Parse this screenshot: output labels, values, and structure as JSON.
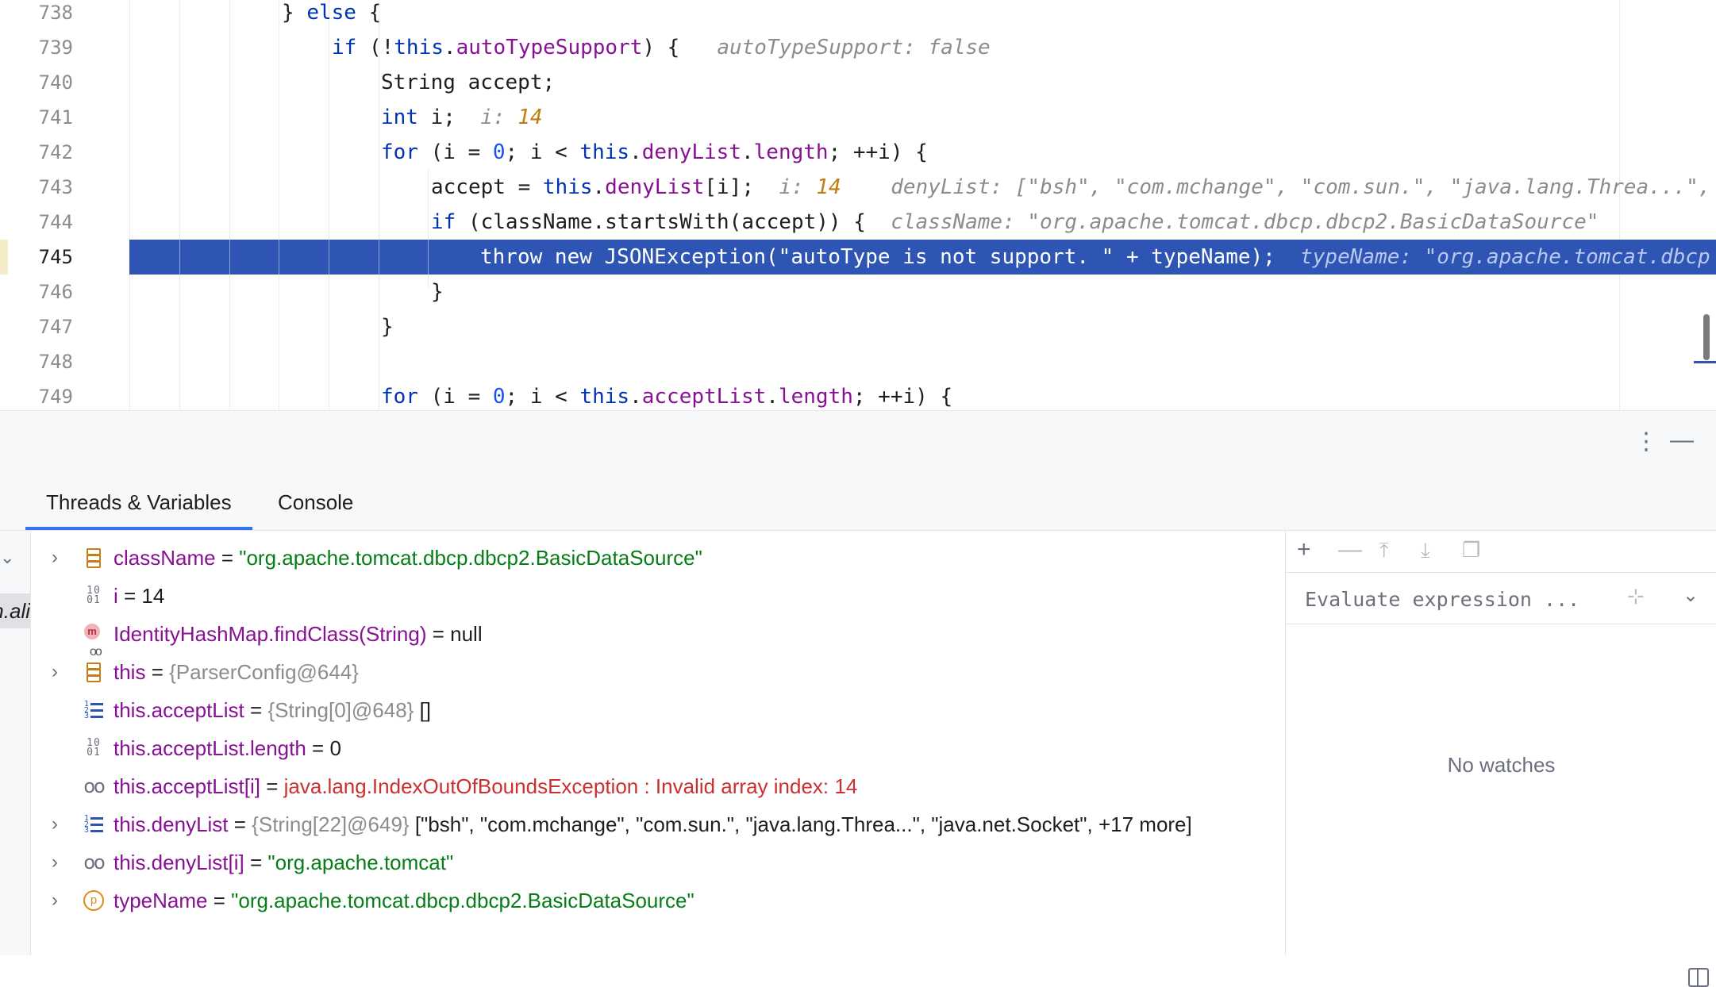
{
  "editor": {
    "current_line": "745",
    "lines": [
      {
        "n": "738"
      },
      {
        "n": "739"
      },
      {
        "n": "740"
      },
      {
        "n": "741"
      },
      {
        "n": "742"
      },
      {
        "n": "743"
      },
      {
        "n": "744"
      },
      {
        "n": "745"
      },
      {
        "n": "746"
      },
      {
        "n": "747"
      },
      {
        "n": "748"
      },
      {
        "n": "749"
      }
    ],
    "code": {
      "l738": {
        "t1": "} ",
        "kw1": "else",
        "t2": " {"
      },
      "l739": {
        "kw1": "if",
        "t1": " (!",
        "kw2": "this",
        "t2": ".",
        "f1": "autoTypeSupport",
        "t3": ") {",
        "hint": "autoTypeSupport: false"
      },
      "l740": {
        "t1": "String accept;"
      },
      "l741": {
        "kw1": "int",
        "t1": " i;",
        "hint_label": "i:",
        "hint_val": "14"
      },
      "l742": {
        "kw1": "for",
        "t1": " (i = ",
        "n1": "0",
        "t2": "; i < ",
        "kw2": "this",
        "t3": ".",
        "f1": "denyList",
        "t4": ".",
        "f2": "length",
        "t5": "; ++i) {"
      },
      "l743": {
        "t1": "accept = ",
        "kw1": "this",
        "t2": ".",
        "f1": "denyList",
        "t3": "[i];",
        "hint_label": "i:",
        "hint_val": "14",
        "hint2": "denyList: [\"bsh\", \"com.mchange\", \"com.sun.\", \"java.lang.Threa...\","
      },
      "l744": {
        "kw1": "if",
        "t1": " (className.startsWith(accept)) {",
        "hint": "className: \"org.apache.tomcat.dbcp.dbcp2.BasicDataSource\""
      },
      "l745": {
        "t1": "throw new JSONException(\"autoType is not support. \" + typeName);",
        "hint": "typeName: \"org.apache.tomcat.dbcp"
      },
      "l746": {
        "t1": "}"
      },
      "l747": {
        "t1": "}"
      },
      "l749": {
        "kw1": "for",
        "t1": " (i = ",
        "n1": "0",
        "t2": "; i < ",
        "kw2": "this",
        "t3": ".",
        "f1": "acceptList",
        "t4": ".",
        "f2": "length",
        "t5": "; ++i) {"
      }
    }
  },
  "debug": {
    "more_icon": "vertical-ellipsis-icon",
    "minimize_icon": "minimize-icon",
    "tabs": [
      {
        "label": "Threads & Variables"
      },
      {
        "label": "Console"
      }
    ],
    "frame_partial": "n.ali",
    "variables": [
      {
        "name": "className",
        "eq": " = ",
        "value": "\"org.apache.tomcat.dbcp.dbcp2.BasicDataSource\"",
        "icon": "object-icon"
      },
      {
        "name": "i",
        "eq": " = ",
        "value": "14",
        "icon": "binary-icon"
      },
      {
        "name": "IdentityHashMap.findClass(String)",
        "eq": " = ",
        "value": "null",
        "icon": "method-icon"
      },
      {
        "name": "this",
        "eq": " = ",
        "ref": "{ParserConfig@644}",
        "icon": "object-icon"
      },
      {
        "name": "this.acceptList",
        "eq": " = ",
        "ref": "{String[0]@648}",
        "value": " []",
        "icon": "list-icon"
      },
      {
        "name": "this.acceptList.length",
        "eq": " = ",
        "value": "0",
        "icon": "binary-icon"
      },
      {
        "name": "this.acceptList[i]",
        "eq": " = ",
        "value": "java.lang.IndexOutOfBoundsException : Invalid array index: 14",
        "icon": "watch-glasses-icon"
      },
      {
        "name": "this.denyList",
        "eq": " = ",
        "ref": "{String[22]@649}",
        "value": " [\"bsh\", \"com.mchange\", \"com.sun.\", \"java.lang.Threa...\", \"java.net.Socket\", +17 more]",
        "icon": "list-icon"
      },
      {
        "name": "this.denyList[i]",
        "eq": " = ",
        "value": "\"org.apache.tomcat\"",
        "icon": "watch-glasses-icon"
      },
      {
        "name": "typeName",
        "eq": " = ",
        "value": "\"org.apache.tomcat.dbcp.dbcp2.BasicDataSource\"",
        "icon": "parameter-icon"
      }
    ],
    "param_badge": "p",
    "method_badge": "m",
    "bin_glyph_top": "10",
    "bin_glyph_bottom": "01",
    "watches": {
      "evaluate_placeholder": "Evaluate expression ...",
      "empty_text": "No watches"
    }
  },
  "colors": {
    "highlight": "#2e55b4",
    "keyword": "#0033b3",
    "field": "#871094",
    "string": "#067d17",
    "error": "#cc2f2f",
    "accent": "#3574f0"
  }
}
